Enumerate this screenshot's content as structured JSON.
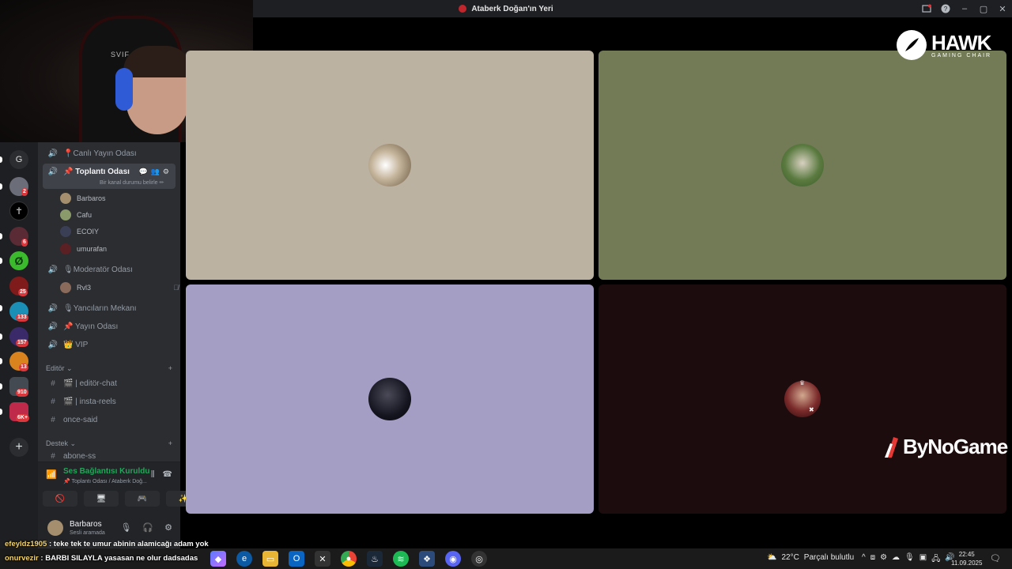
{
  "window": {
    "title": "Ataberk Doğan'ın Yeri"
  },
  "channels": [
    {
      "name": "📍Canlı Yayın Odası",
      "type": "voice"
    },
    {
      "name": "📌 Toplantı Odası",
      "type": "voice",
      "active": true
    },
    {
      "name": "🎙Moderatör Odası",
      "type": "voice"
    },
    {
      "name": "🎙Yancıların Mekanı",
      "type": "voice"
    },
    {
      "name": "📌 Yayın Odası",
      "type": "voice"
    },
    {
      "name": "👑 VIP",
      "type": "voice"
    }
  ],
  "channel_status": "Bir kanal durumu belirle ✏",
  "voice_members": [
    "Barbaros",
    "Cafu",
    "ECOIY",
    "umurafan"
  ],
  "moderator_member": "Rvl3",
  "categories": {
    "editor": "Editör",
    "destek": "Destek"
  },
  "text_channels": [
    "🎬 | editör-chat",
    "🎬 | insta-reels",
    "once-said",
    "abone-ss"
  ],
  "voice_panel": {
    "title": "Ses Bağlantısı Kuruldu",
    "subtitle": "📌 Toplantı Odası / Ataberk Doğ..."
  },
  "user": {
    "name": "Barbaros",
    "status": "Sesli aramada"
  },
  "server_badges": [
    "2",
    "6",
    "25",
    "133",
    "157",
    "13",
    "910",
    "6K+"
  ],
  "webcam": {
    "chair_label": "SVIF"
  },
  "video_tiles": [
    {
      "bg": "#bcb2a1"
    },
    {
      "bg": "#737b56"
    },
    {
      "bg": "#a49ec5"
    },
    {
      "bg": "#1c0c0e"
    }
  ],
  "sponsors": {
    "hawk": "HAWK",
    "hawk_sub": "GAMING CHAIR",
    "bynogame": "ByNoGame"
  },
  "chat": [
    {
      "user": "efeyldz1905",
      "text": " : teke tek te umur abinin alamicağı adam yok"
    },
    {
      "user": "onurvezir",
      "text": " : BARBI SILAYLA yasasan ne olur dadsadas"
    }
  ],
  "taskbar": {
    "weather_temp": "22°C",
    "weather_text": "Parçalı bulutlu",
    "time": "22:45",
    "date": "11.09.2025"
  },
  "colors": {
    "online": "#23a55a",
    "badge": "#da373c",
    "sidebar": "#2b2d31"
  }
}
